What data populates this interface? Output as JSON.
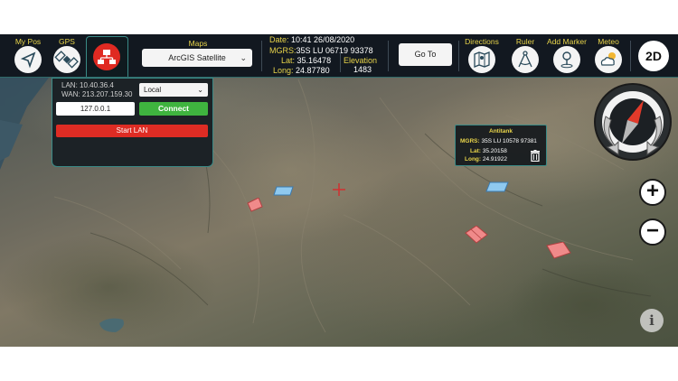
{
  "toolbar": {
    "my_pos_label": "My Pos",
    "gps_label": "GPS",
    "maps_label": "Maps",
    "maps_selected": "ArcGIS Satellite",
    "date_prefix": "Date:",
    "date_value": "10:41  26/08/2020",
    "mgrs_prefix": "MGRS:",
    "mgrs_value": "35S LU 06719 93378",
    "lat_prefix": "Lat:",
    "lat_value": "35.16478",
    "long_prefix": "Long:",
    "long_value": "24.87780",
    "elevation_label": "Elevation",
    "elevation_value": "1483",
    "goto_label": "Go To",
    "directions_label": "Directions",
    "ruler_label": "Ruler",
    "add_marker_label": "Add Marker",
    "meteo_label": "Meteo",
    "mode_label": "2D"
  },
  "lan": {
    "lan_ip_line": "LAN: 10.40.36.4",
    "wan_ip_line": "WAN: 213.207.159.30",
    "mode_selected": "Local",
    "ip_value": "127.0.0.1",
    "connect_label": "Connect",
    "start_label": "Start LAN"
  },
  "marker_popup": {
    "title": "Antitank",
    "mgrs_key": "MGRS:",
    "mgrs_value": "35S LU 10578 97381",
    "lat_key": "Lat:",
    "lat_value": "35.20158",
    "long_key": "Long:",
    "long_value": "24.91922"
  },
  "controls": {
    "zoom_in": "+",
    "zoom_out": "−",
    "info": "i"
  },
  "colors": {
    "accent": "#e8d44a",
    "bar_bg": "#121820",
    "teal_border": "#3a8a86",
    "connect": "#3fb43f",
    "start": "#de2c24",
    "friendly": "#8fc9ef",
    "hostile": "#f08a8a"
  },
  "icons": [
    "location-arrow-icon",
    "satellite-icon",
    "network-icon",
    "chevron-down-icon",
    "map-directions-icon",
    "compass-ruler-icon",
    "map-pin-icon",
    "weather-icon",
    "compass-icon",
    "trash-icon",
    "info-icon",
    "crosshair-icon"
  ]
}
